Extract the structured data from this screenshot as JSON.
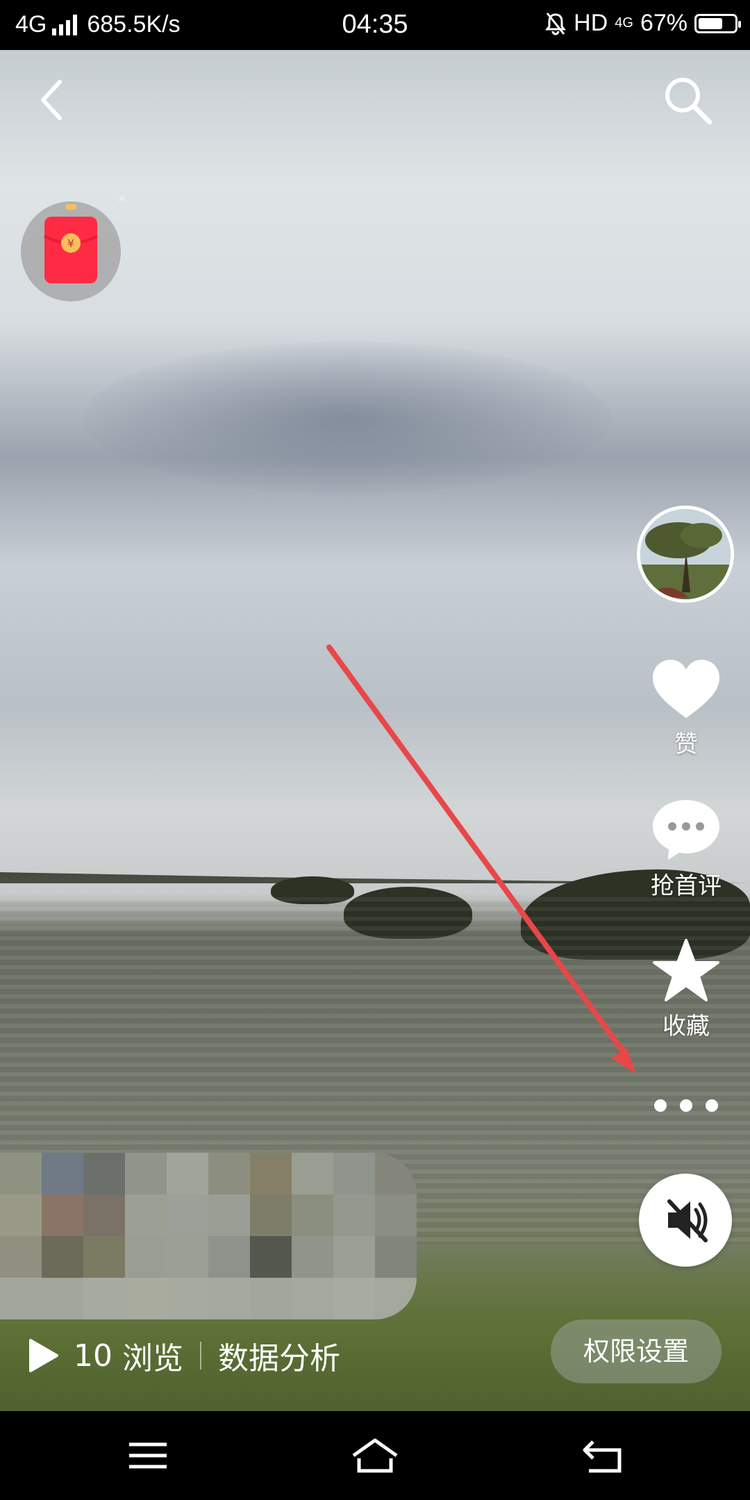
{
  "status_bar": {
    "network": "4G",
    "speed": "685.5K/s",
    "time": "04:35",
    "hd": "HD",
    "net_type": "4G",
    "battery_text": "67%",
    "battery_level": 0.67
  },
  "video": {
    "views_count": "10",
    "views_label": "浏览",
    "analytics_label": "数据分析",
    "permission_label": "权限设置"
  },
  "actions": {
    "like_label": "赞",
    "comment_label": "抢首评",
    "favorite_label": "收藏"
  },
  "redpacket": {
    "currency_symbol": "¥",
    "close_symbol": "×"
  },
  "colors": {
    "arrow": "#e8474a",
    "redpacket": "#ff2b44"
  }
}
